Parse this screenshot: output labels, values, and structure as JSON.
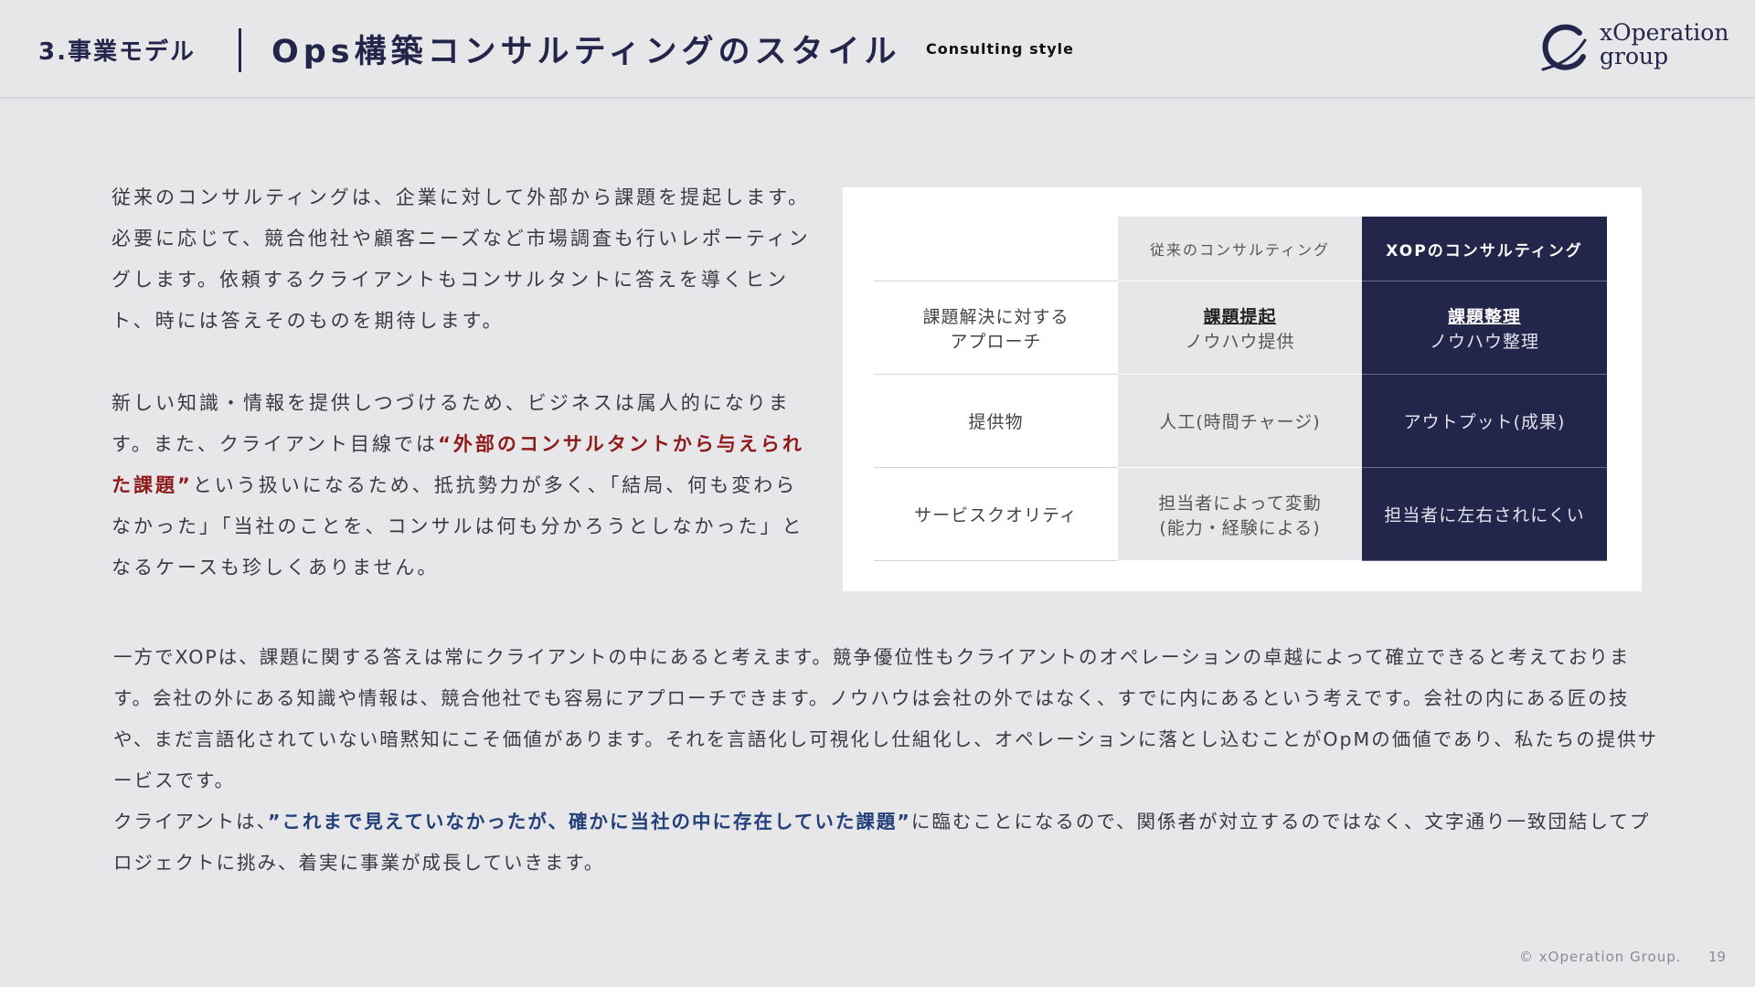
{
  "header": {
    "section": "3.事業モデル",
    "title": "Ops構築コンサルティングのスタイル",
    "subtitle": "Consulting style",
    "logo_line1": "xOperation",
    "logo_line2": "group"
  },
  "intro": {
    "p1": "従来のコンサルティングは、企業に対して外部から課題を提起します。必要に応じて、競合他社や顧客ニーズなど市場調査も行いレポーティングします。依頼するクライアントもコンサルタントに答えを導くヒント、時には答えそのものを期待します。",
    "p2_a": "新しい知識・情報を提供しつづけるため、ビジネスは属人的になります。また、クライアント目線では",
    "p2_highlight": "“外部のコンサルタントから与えられた課題”",
    "p2_b": "という扱いになるため、抵抗勢力が多く、「結局、何も変わらなかった」「当社のことを、コンサルは何も分かろうとしなかった」となるケースも珍しくありません。"
  },
  "table": {
    "headers": [
      "",
      "従来のコンサルティング",
      "XOPのコンサルティング"
    ],
    "rows": [
      {
        "label": [
          "課題解決に対する",
          "アプローチ"
        ],
        "traditional": {
          "strong": "課題提起",
          "text": "ノウハウ提供"
        },
        "xop": {
          "strong": "課題整理",
          "text": "ノウハウ整理"
        }
      },
      {
        "label": [
          "提供物"
        ],
        "traditional": {
          "strong": "",
          "text": "人工(時間チャージ)"
        },
        "xop": {
          "strong": "",
          "text": "アウトプット(成果)"
        }
      },
      {
        "label": [
          "サービスクオリティ"
        ],
        "traditional": {
          "strong": "",
          "text": "担当者によって変動",
          "text2": "(能力・経験による)"
        },
        "xop": {
          "strong": "",
          "text": "担当者に左右されにくい"
        }
      }
    ]
  },
  "body": {
    "p3": "一方でXOPは、課題に関する答えは常にクライアントの中にあると考えます。競争優位性もクライアントのオペレーションの卓越によって確立できると考えております。会社の外にある知識や情報は、競合他社でも容易にアプローチできます。ノウハウは会社の外ではなく、すでに内にあるという考えです。会社の内にある匠の技や、まだ言語化されていない暗黙知にこそ価値があります。それを言語化し可視化し仕組化し、オペレーションに落とし込むことがOpMの価値であり、私たちの提供サービスです。",
    "p4_a": "クライアントは、",
    "p4_highlight": "”これまで見えていなかったが、確かに当社の中に存在していた課題”",
    "p4_b": "に臨むことになるので、関係者が対立するのではなく、文字通り一致団結してプロジェクトに挑み、着実に事業が成長していきます。"
  },
  "footer": {
    "copyright": "© xOperation Group.",
    "page": "19"
  },
  "colors": {
    "navy": "#23254a",
    "highlight_red": "#8e1a1a",
    "highlight_blue": "#23407a",
    "background": "#e7e7ea"
  }
}
